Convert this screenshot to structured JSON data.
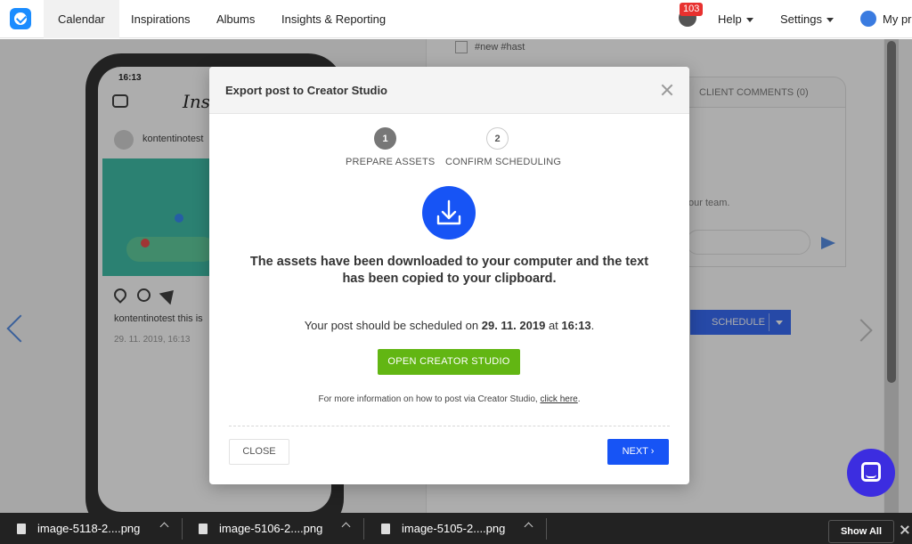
{
  "nav": {
    "items": [
      {
        "label": "Calendar",
        "active": true
      },
      {
        "label": "Inspirations"
      },
      {
        "label": "Albums"
      },
      {
        "label": "Insights & Reporting"
      }
    ],
    "notifications_count": "103",
    "help_label": "Help",
    "settings_label": "Settings",
    "profile_label": "My pr"
  },
  "background": {
    "phone_time": "16:13",
    "ig_brand": "Inst",
    "ig_username": "kontentinotest",
    "ig_caption": "kontentinotest this is",
    "ig_date": "29. 11. 2019, 16:13",
    "hashtags": "#new #hast",
    "client_comments_tab": "CLIENT COMMENTS (0)",
    "comments_hint": "our team.",
    "schedule_label": "SCHEDULE"
  },
  "modal": {
    "title": "Export post to Creator Studio",
    "steps": [
      {
        "number": "1",
        "label": "PREPARE ASSETS",
        "active": true
      },
      {
        "number": "2",
        "label": "CONFIRM SCHEDULING",
        "active": false
      }
    ],
    "main_message": "The assets have been downloaded to your computer and the text has been copied to your clipboard.",
    "schedule_prefix": "Your post should be scheduled on",
    "schedule_date": "29. 11. 2019",
    "schedule_at": "at",
    "schedule_time": "16:13",
    "schedule_suffix": ".",
    "open_button": "OPEN CREATOR STUDIO",
    "info_prefix": "For more information on how to post via Creator Studio,",
    "info_link": "click here",
    "info_suffix": ".",
    "close_button": "CLOSE",
    "next_button": "NEXT ›"
  },
  "downloads": {
    "files": [
      "image-5118-2....png",
      "image-5106-2....png",
      "image-5105-2....png"
    ],
    "show_all": "Show All"
  },
  "colors": {
    "primary": "#1754f5",
    "success": "#62b613",
    "badge": "#e8312f",
    "chat": "#3c2de0"
  }
}
